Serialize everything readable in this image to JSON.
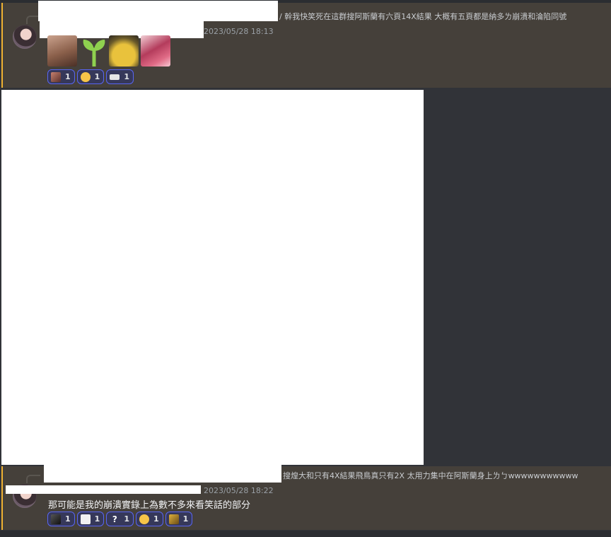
{
  "messages": [
    {
      "reply_preview": "/ 幹我快笑死在這群搜阿斯蘭有六頁14X結果 大概有五頁都是納多ㄌ崩潰和淪陷同號",
      "timestamp": "2023/05/28 18:13",
      "stickers": [
        "laughing-man-sticker",
        "sprout-sticker",
        "pikachu-sticker",
        "anime-girl-sticker"
      ],
      "reactions": [
        {
          "emoji": "anime-face-emoji",
          "count": "1"
        },
        {
          "emoji": "slightly-smiling-emoji",
          "count": "1"
        },
        {
          "emoji": "sign-emoji",
          "count": "1"
        }
      ]
    },
    {
      "reply_preview": "搜煌大和只有4X結果飛鳥真只有2X 太用力集中在阿斯蘭身上ㄌㄅwwwwwwwwwww",
      "timestamp": "2023/05/28 18:22",
      "text": "那可能是我的崩潰實錄上為數不多來看笑話的部分",
      "reactions": [
        {
          "emoji": "dark-figure-emoji",
          "count": "1"
        },
        {
          "emoji": "white-card-emoji",
          "count": "1"
        },
        {
          "emoji": "question-mark-emoji",
          "symbol": "?",
          "count": "1"
        },
        {
          "emoji": "crying-face-emoji",
          "count": "1"
        },
        {
          "emoji": "golden-image-emoji",
          "count": "1"
        }
      ]
    }
  ],
  "colors": {
    "background": "#313338",
    "highlighted_message": "#45403a",
    "mention_bar": "#f0b232",
    "reaction_border": "#5865f2",
    "reaction_bg": "#36385a"
  }
}
